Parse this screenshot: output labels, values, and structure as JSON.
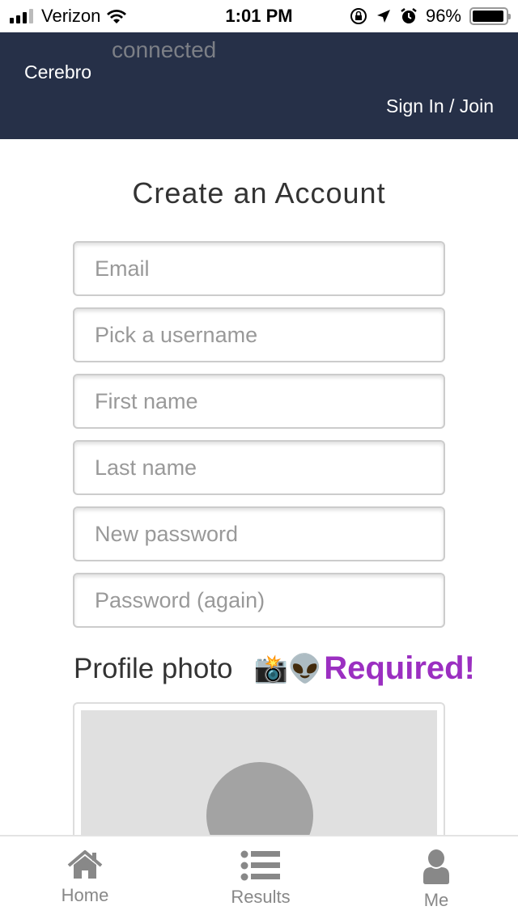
{
  "status_bar": {
    "carrier": "Verizon",
    "time": "1:01 PM",
    "battery": "96%",
    "battery_level": 0.96,
    "icons": [
      "signal-icon",
      "wifi-icon",
      "orientation-lock-icon",
      "location-icon",
      "alarm-icon",
      "battery-icon"
    ]
  },
  "navbar": {
    "brand": "Cerebro",
    "connection_status": "connected",
    "signin_label": "Sign In / Join",
    "background": "#263048"
  },
  "form": {
    "title": "Create an Account",
    "fields": [
      {
        "name": "email",
        "placeholder": "Email",
        "value": ""
      },
      {
        "name": "username",
        "placeholder": "Pick a username",
        "value": ""
      },
      {
        "name": "first-name",
        "placeholder": "First name",
        "value": ""
      },
      {
        "name": "last-name",
        "placeholder": "Last name",
        "value": ""
      },
      {
        "name": "new-password",
        "placeholder": "New password",
        "value": ""
      },
      {
        "name": "password-again",
        "placeholder": "Password (again)",
        "value": ""
      }
    ],
    "profile_photo": {
      "label": "Profile photo",
      "emoji": "📸👽",
      "required_label": "Required!",
      "required_color": "#9b2fc1"
    }
  },
  "tabbar": {
    "items": [
      {
        "label": "Home",
        "icon": "home-icon"
      },
      {
        "label": "Results",
        "icon": "list-icon"
      },
      {
        "label": "Me",
        "icon": "user-icon"
      }
    ]
  }
}
